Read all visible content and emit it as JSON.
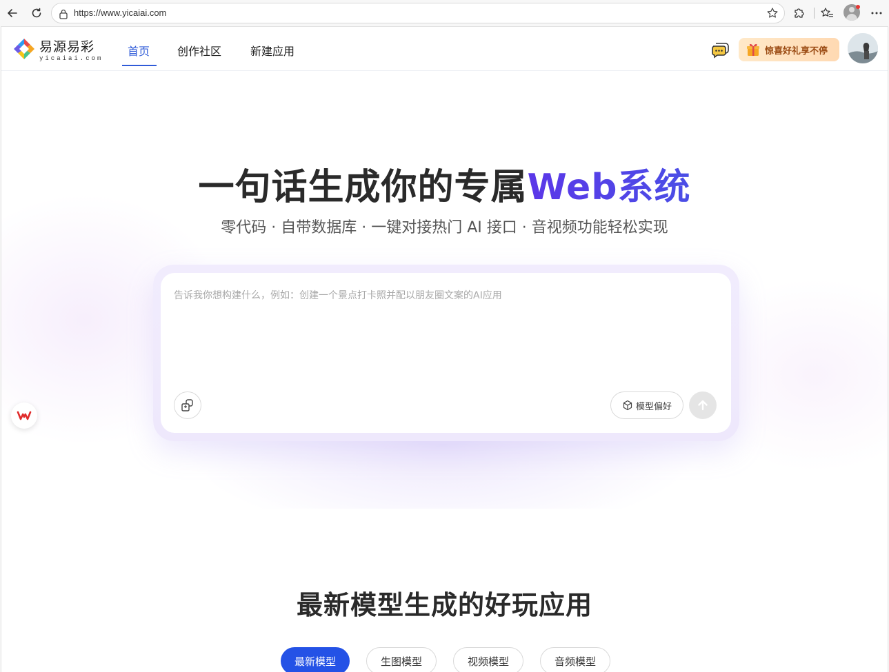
{
  "browser": {
    "url": "https://www.yicaiai.com"
  },
  "header": {
    "logo_cn": "易源易彩",
    "logo_en": "yicaiai.com",
    "nav": [
      {
        "label": "首页",
        "active": true
      },
      {
        "label": "创作社区",
        "active": false
      },
      {
        "label": "新建应用",
        "active": false
      }
    ],
    "gift_label": "惊喜好礼享不停"
  },
  "hero": {
    "title_main": "一句话生成你的专属",
    "title_highlight": "Web系统",
    "subtitle": "零代码 · 自带数据库 · 一键对接热门 AI 接口 · 音视频功能轻松实现",
    "prompt_placeholder": "告诉我你想构建什么，例如：创建一个景点打卡照并配以朋友圈文案的AI应用",
    "model_button": "模型偏好"
  },
  "section": {
    "title": "最新模型生成的好玩应用",
    "tabs": [
      {
        "label": "最新模型",
        "active": true
      },
      {
        "label": "生图模型",
        "active": false
      },
      {
        "label": "视频模型",
        "active": false
      },
      {
        "label": "音频模型",
        "active": false
      }
    ]
  },
  "colors": {
    "accent": "#2f5bd8",
    "tab_active": "#2452e6",
    "title_gradient_start": "#5b37e8",
    "title_gradient_end": "#4a4ee6"
  }
}
